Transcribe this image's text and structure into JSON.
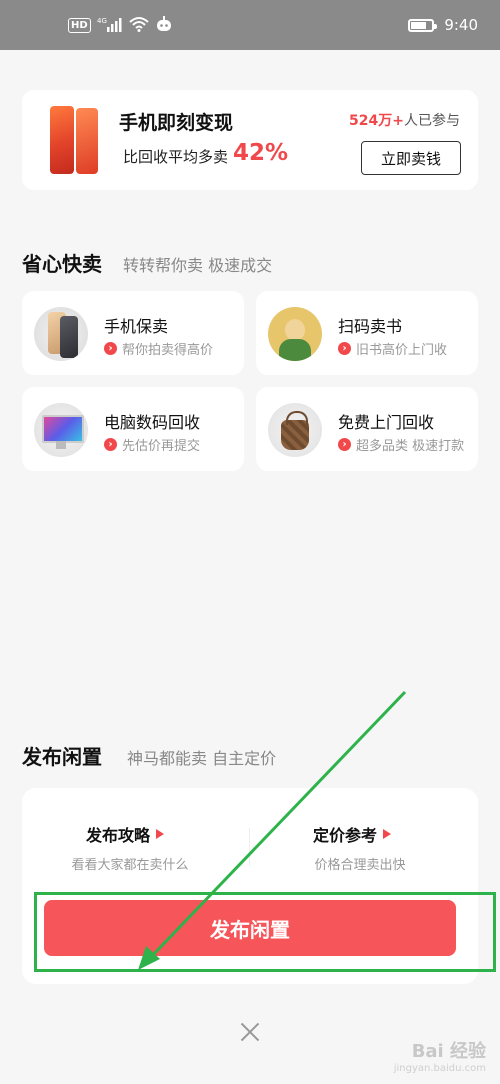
{
  "status_bar": {
    "network_badge": "HD",
    "signal_text": "4G",
    "time": "9:40"
  },
  "promo": {
    "title": "手机即刻变现",
    "subtitle": "比回收平均多卖",
    "percent": "42%",
    "participants_count": "524万+",
    "participants_suffix": "人已参与",
    "button_label": "立即卖钱"
  },
  "quick_sell": {
    "title": "省心快卖",
    "subtitle": "转转帮你卖 极速成交",
    "items": [
      {
        "name": "手机保卖",
        "desc": "帮你拍卖得高价",
        "icon": "iphone-icon"
      },
      {
        "name": "扫码卖书",
        "desc": "旧书高价上门收",
        "icon": "book-icon"
      },
      {
        "name": "电脑数码回收",
        "desc": "先估价再提交",
        "icon": "computer-icon"
      },
      {
        "name": "免费上门回收",
        "desc": "超多品类 极速打款",
        "icon": "bag-icon"
      }
    ]
  },
  "publish": {
    "title": "发布闲置",
    "subtitle": "神马都能卖 自主定价",
    "links": [
      {
        "label": "发布攻略",
        "desc": "看看大家都在卖什么"
      },
      {
        "label": "定价参考",
        "desc": "价格合理卖出快"
      }
    ],
    "button_label": "发布闲置"
  },
  "watermark": {
    "text": "Bai 经验",
    "sub": "jingyan.baidu.com"
  },
  "colors": {
    "accent": "#f0484b",
    "button": "#f6555a",
    "annotation": "#2db34a"
  }
}
